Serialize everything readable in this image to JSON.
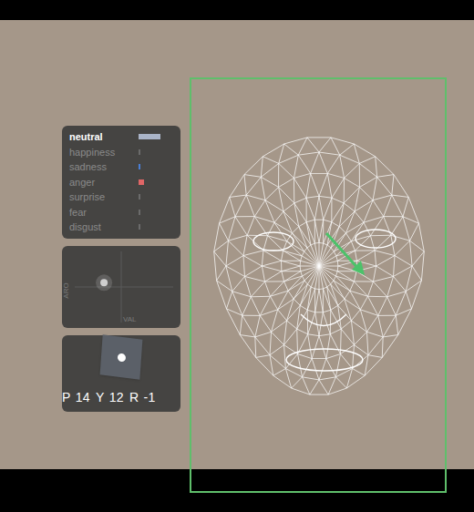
{
  "emotions": [
    {
      "label": "neutral",
      "level": 0.62,
      "selected": true,
      "color": "#aab4c8"
    },
    {
      "label": "happiness",
      "level": 0.02,
      "selected": false,
      "color": "#6b6b6b"
    },
    {
      "label": "sadness",
      "level": 0.05,
      "selected": false,
      "color": "#4a7fd6"
    },
    {
      "label": "anger",
      "level": 0.16,
      "selected": false,
      "color": "#e06666"
    },
    {
      "label": "surprise",
      "level": 0.02,
      "selected": false,
      "color": "#6b6b6b"
    },
    {
      "label": "fear",
      "level": 0.01,
      "selected": false,
      "color": "#6b6b6b"
    },
    {
      "label": "disgust",
      "level": 0.02,
      "selected": false,
      "color": "#6b6b6b"
    }
  ],
  "affect_chart": {
    "x_label": "VAL",
    "y_label": "ARO",
    "valence": [
      -0.35
    ],
    "arousal": [
      0.12
    ]
  },
  "head_pose": [
    {
      "label": "P",
      "value": "14"
    },
    {
      "label": "Y",
      "value": "12"
    },
    {
      "label": "R",
      "value": "-1"
    }
  ],
  "face": {
    "tracked": true
  }
}
